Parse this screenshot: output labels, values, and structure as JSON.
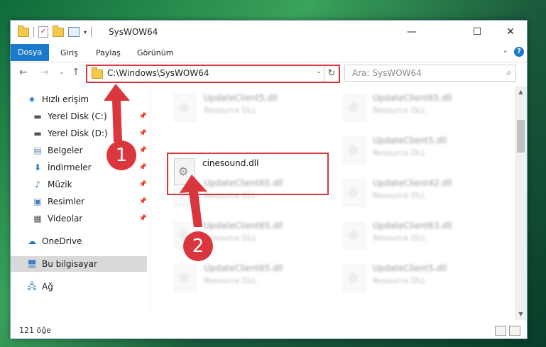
{
  "window": {
    "title": "SysWOW64",
    "controls": {
      "minimize": "—",
      "maximize": "☐",
      "close": "✕"
    }
  },
  "ribbon": {
    "tabs": [
      "Dosya",
      "Giriş",
      "Paylaş",
      "Görünüm"
    ],
    "active_tab": "Dosya"
  },
  "nav": {
    "address": "C:\\Windows\\SysWOW64",
    "search_placeholder": "Ara: SysWOW64"
  },
  "sidebar": {
    "items": [
      {
        "label": "Hızlı erişim",
        "icon": "star-icon",
        "pinned": false
      },
      {
        "label": "Yerel Disk (C:)",
        "icon": "drive-icon",
        "pinned": true
      },
      {
        "label": "Yerel Disk (D:)",
        "icon": "drive-icon",
        "pinned": true
      },
      {
        "label": "Belgeler",
        "icon": "documents-icon",
        "pinned": true
      },
      {
        "label": "İndirmeler",
        "icon": "download-icon",
        "pinned": true
      },
      {
        "label": "Müzik",
        "icon": "music-icon",
        "pinned": true
      },
      {
        "label": "Resimler",
        "icon": "pictures-icon",
        "pinned": true
      },
      {
        "label": "Videolar",
        "icon": "videos-icon",
        "pinned": true
      },
      {
        "label": "OneDrive",
        "icon": "cloud-icon",
        "pinned": false
      },
      {
        "label": "Bu bilgisayar",
        "icon": "computer-icon",
        "pinned": false,
        "selected": true
      },
      {
        "label": "Ağ",
        "icon": "network-icon",
        "pinned": false
      }
    ]
  },
  "files": [
    {
      "name": "UpdateClient5.dll",
      "type": "Resource DLL"
    },
    {
      "name": "UpdateClient65.dll",
      "type": "Resource DLL"
    },
    {
      "name": "cinesound.dll",
      "type": "",
      "highlighted": true
    },
    {
      "name": "UpdateClient5.dll",
      "type": "Resource DLL"
    },
    {
      "name": "UpdateClient65.dll",
      "type": "Resource DLL"
    },
    {
      "name": "UpdateClient42.dll",
      "type": "Resource DLL"
    },
    {
      "name": "UpdateClient65.dll",
      "type": "Resource DLL"
    },
    {
      "name": "UpdateClient63.dll",
      "type": "Resource DLL"
    },
    {
      "name": "UpdateClient65.dll",
      "type": "Resource DLL"
    },
    {
      "name": "UpdateClient5.dll",
      "type": "Resource DLL"
    }
  ],
  "status": {
    "count": "121 öğe"
  },
  "annotations": {
    "step1": "1",
    "step2": "2"
  },
  "colors": {
    "accent": "#1979ca",
    "highlight": "#d9363e"
  }
}
